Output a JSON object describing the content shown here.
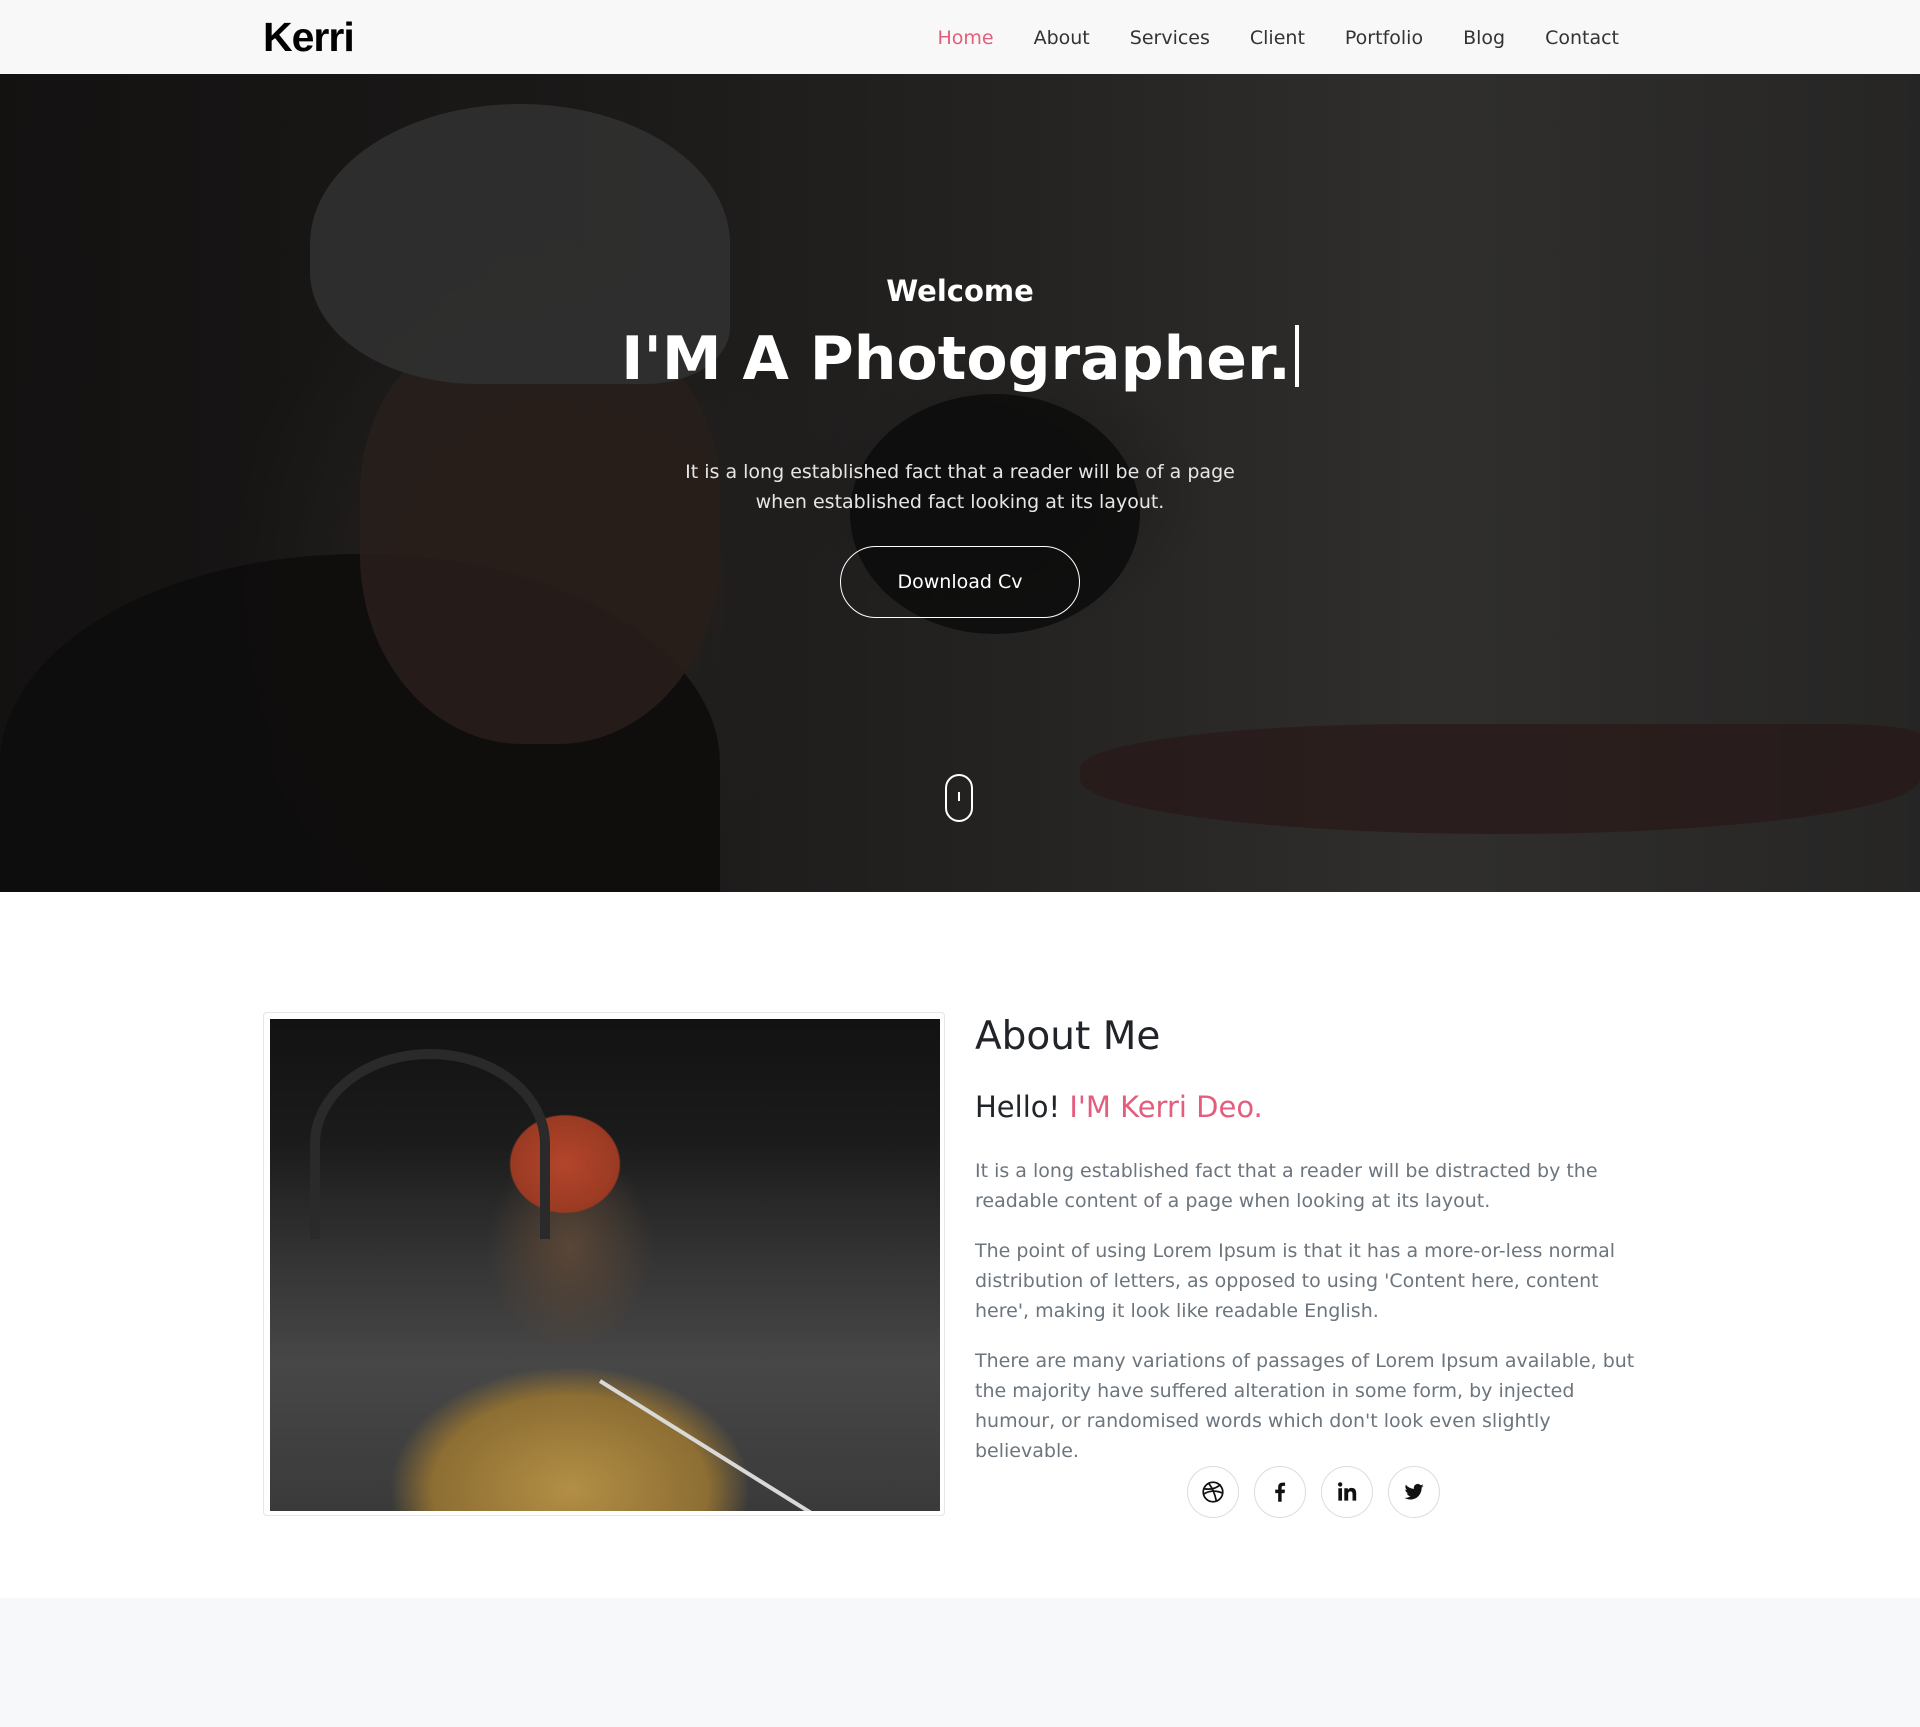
{
  "brand": "Kerri",
  "nav": [
    "Home",
    "About",
    "Services",
    "Client",
    "Portfolio",
    "Blog",
    "Contact"
  ],
  "hero": {
    "welcome": "Welcome",
    "headline": "I'M A Photographer.",
    "description": "It is a long established fact that a reader will be of a page when established fact looking at its layout.",
    "button": "Download Cv"
  },
  "about": {
    "title": "About Me",
    "hello": "Hello!",
    "name": "I'M Kerri Deo.",
    "paragraphs": [
      "It is a long established fact that a reader will be distracted by the readable content of a page when looking at its layout.",
      "The point of using Lorem Ipsum is that it has a more-or-less normal distribution of letters, as opposed to using 'Content here, content here', making it look like readable English.",
      "There are many variations of passages of Lorem Ipsum available, but the majority have suffered alteration in some form, by injected humour, or randomised words which don't look even slightly believable."
    ],
    "socials": [
      "dribbble-icon",
      "facebook-icon",
      "linkedin-icon",
      "twitter-icon"
    ]
  },
  "colors": {
    "accent": "#e35e7d",
    "navbar": "#f8f8f8",
    "text": "#212529",
    "muted": "#6c757d"
  }
}
